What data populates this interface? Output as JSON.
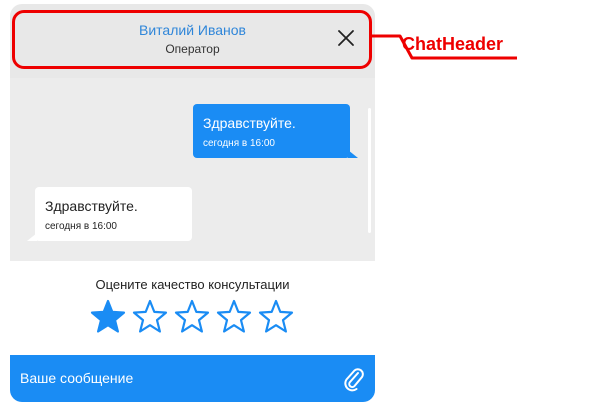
{
  "chat_header": {
    "operator_name": "Виталий Иванов",
    "operator_role": "Оператор",
    "close_icon": "close-icon"
  },
  "messages": [
    {
      "direction": "outgoing",
      "text": "Здравствуйте.",
      "time": "сегодня в 16:00"
    },
    {
      "direction": "incoming",
      "text": "Здравствуйте.",
      "time": "сегодня в 16:00"
    }
  ],
  "rating": {
    "title": "Оцените качество консультации",
    "value": 1,
    "max": 5
  },
  "composer": {
    "placeholder": "Ваше сообщение",
    "attach_icon": "paperclip-icon"
  },
  "annotation": {
    "label": "ChatHeader",
    "color": "#ee0000"
  },
  "colors": {
    "accent": "#1a8cf4",
    "operator_name": "#2f86d9",
    "header_bg": "#e8e8e8",
    "messages_bg": "#ececec"
  }
}
